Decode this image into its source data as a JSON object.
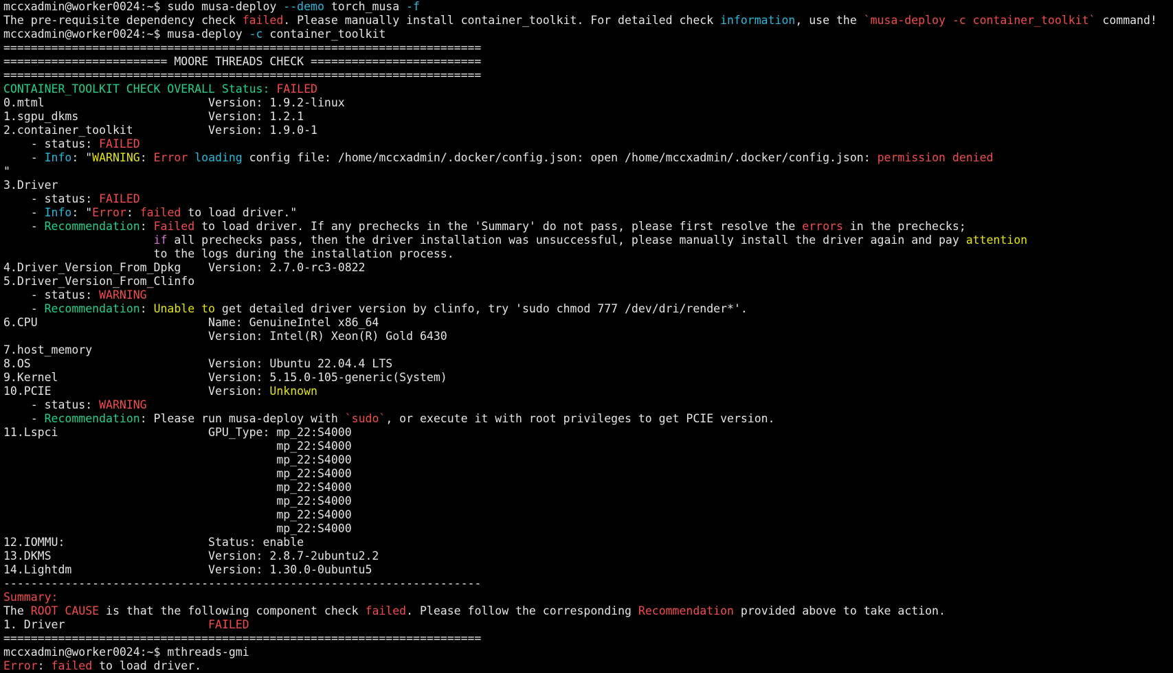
{
  "palette": {
    "default": "#e5e5e5",
    "red": "#f14c4c",
    "green": "#23d18b",
    "yellow": "#e5e510",
    "cyan": "#29b8db",
    "magenta": "#d670d6",
    "background": "#000000"
  },
  "terminal": {
    "lines": [
      [
        {
          "t": "mccxadmin@worker0024:~$ sudo musa-deploy ",
          "c": "default"
        },
        {
          "t": "--demo",
          "c": "cyan"
        },
        {
          "t": " torch_musa ",
          "c": "default"
        },
        {
          "t": "-f",
          "c": "cyan"
        }
      ],
      [
        {
          "t": "The pre-requisite dependency check ",
          "c": "default"
        },
        {
          "t": "failed",
          "c": "red"
        },
        {
          "t": ". Please manually install container_toolkit. For detailed check ",
          "c": "default"
        },
        {
          "t": "information",
          "c": "cyan"
        },
        {
          "t": ", use the ",
          "c": "default"
        },
        {
          "t": "`musa-deploy -c container_toolkit`",
          "c": "red"
        },
        {
          "t": " command!",
          "c": "default"
        }
      ],
      [
        {
          "t": "mccxadmin@worker0024:~$ musa-deploy ",
          "c": "default"
        },
        {
          "t": "-c",
          "c": "cyan"
        },
        {
          "t": " container_toolkit",
          "c": "default"
        }
      ],
      [
        {
          "t": "======================================================================",
          "c": "default"
        }
      ],
      [
        {
          "t": "======================== MOORE THREADS CHECK =========================",
          "c": "default"
        }
      ],
      [
        {
          "t": "======================================================================",
          "c": "default"
        }
      ],
      [
        {
          "t": "CONTAINER_TOOLKIT CHECK OVERALL Status: ",
          "c": "green"
        },
        {
          "t": "FAILED",
          "c": "red"
        }
      ],
      [
        {
          "t": "0.mtml                        Version: 1.9.2-linux",
          "c": "default"
        }
      ],
      [
        {
          "t": "1.sgpu_dkms                   Version: 1.2.1",
          "c": "default"
        }
      ],
      [
        {
          "t": "2.container_toolkit           Version: 1.9.0-1",
          "c": "default"
        }
      ],
      [
        {
          "t": "    - status: ",
          "c": "default"
        },
        {
          "t": "FAILED",
          "c": "red"
        }
      ],
      [
        {
          "t": "    - ",
          "c": "default"
        },
        {
          "t": "Info",
          "c": "cyan"
        },
        {
          "t": ": \"",
          "c": "default"
        },
        {
          "t": "WARNING",
          "c": "yellow"
        },
        {
          "t": ": ",
          "c": "default"
        },
        {
          "t": "Error",
          "c": "red"
        },
        {
          "t": " ",
          "c": "default"
        },
        {
          "t": "loading",
          "c": "cyan"
        },
        {
          "t": " config file: /home/mccxadmin/.docker/config.json: open /home/mccxadmin/.docker/config.json: ",
          "c": "default"
        },
        {
          "t": "permission denied",
          "c": "red"
        }
      ],
      [
        {
          "t": "\"",
          "c": "default"
        }
      ],
      [
        {
          "t": "3.Driver",
          "c": "default"
        }
      ],
      [
        {
          "t": "    - status: ",
          "c": "default"
        },
        {
          "t": "FAILED",
          "c": "red"
        }
      ],
      [
        {
          "t": "    - ",
          "c": "default"
        },
        {
          "t": "Info",
          "c": "cyan"
        },
        {
          "t": ": \"",
          "c": "default"
        },
        {
          "t": "Error",
          "c": "red"
        },
        {
          "t": ": ",
          "c": "default"
        },
        {
          "t": "failed",
          "c": "red"
        },
        {
          "t": " to load driver.\"",
          "c": "default"
        }
      ],
      [
        {
          "t": "    - ",
          "c": "default"
        },
        {
          "t": "Recommendation",
          "c": "green"
        },
        {
          "t": ": ",
          "c": "default"
        },
        {
          "t": "Failed",
          "c": "red"
        },
        {
          "t": " to load driver. If any prechecks in the 'Summary' do not pass, please first resolve the ",
          "c": "default"
        },
        {
          "t": "errors",
          "c": "red"
        },
        {
          "t": " in the prechecks;",
          "c": "default"
        }
      ],
      [
        {
          "t": "                      ",
          "c": "default"
        },
        {
          "t": "if",
          "c": "magenta"
        },
        {
          "t": " all prechecks pass, then the driver installation was unsuccessful, please manually install the driver again and pay ",
          "c": "default"
        },
        {
          "t": "attention",
          "c": "yellow"
        }
      ],
      [
        {
          "t": "                      to the logs during the installation process.",
          "c": "default"
        }
      ],
      [
        {
          "t": "4.Driver_Version_From_Dpkg    Version: 2.7.0-rc3-0822",
          "c": "default"
        }
      ],
      [
        {
          "t": "5.Driver_Version_From_Clinfo",
          "c": "default"
        }
      ],
      [
        {
          "t": "    - status: ",
          "c": "default"
        },
        {
          "t": "WARNING",
          "c": "red"
        }
      ],
      [
        {
          "t": "    - ",
          "c": "default"
        },
        {
          "t": "Recommendation",
          "c": "green"
        },
        {
          "t": ": ",
          "c": "default"
        },
        {
          "t": "Unable to",
          "c": "yellow"
        },
        {
          "t": " get detailed driver version by clinfo, try 'sudo chmod 777 /dev/dri/render*'.",
          "c": "default"
        }
      ],
      [
        {
          "t": "6.CPU                         Name: GenuineIntel x86_64",
          "c": "default"
        }
      ],
      [
        {
          "t": "                              Version: Intel(R) Xeon(R) Gold 6430",
          "c": "default"
        }
      ],
      [
        {
          "t": "7.host_memory",
          "c": "default"
        }
      ],
      [
        {
          "t": "8.OS                          Version: Ubuntu 22.04.4 LTS",
          "c": "default"
        }
      ],
      [
        {
          "t": "9.Kernel                      Version: 5.15.0-105-generic(System)",
          "c": "default"
        }
      ],
      [
        {
          "t": "10.PCIE                       Version: ",
          "c": "default"
        },
        {
          "t": "Unknown",
          "c": "yellow"
        }
      ],
      [
        {
          "t": "    - status: ",
          "c": "default"
        },
        {
          "t": "WARNING",
          "c": "red"
        }
      ],
      [
        {
          "t": "    - ",
          "c": "default"
        },
        {
          "t": "Recommendation",
          "c": "green"
        },
        {
          "t": ": Please run musa-deploy with ",
          "c": "default"
        },
        {
          "t": "`sudo`",
          "c": "red"
        },
        {
          "t": ", or execute it with root privileges to get PCIE version.",
          "c": "default"
        }
      ],
      [
        {
          "t": "11.Lspci                      GPU_Type: mp_22:S4000",
          "c": "default"
        }
      ],
      [
        {
          "t": "                                        mp_22:S4000",
          "c": "default"
        }
      ],
      [
        {
          "t": "                                        mp_22:S4000",
          "c": "default"
        }
      ],
      [
        {
          "t": "                                        mp_22:S4000",
          "c": "default"
        }
      ],
      [
        {
          "t": "                                        mp_22:S4000",
          "c": "default"
        }
      ],
      [
        {
          "t": "                                        mp_22:S4000",
          "c": "default"
        }
      ],
      [
        {
          "t": "                                        mp_22:S4000",
          "c": "default"
        }
      ],
      [
        {
          "t": "                                        mp_22:S4000",
          "c": "default"
        }
      ],
      [
        {
          "t": "12.IOMMU:                     Status: enable",
          "c": "default"
        }
      ],
      [
        {
          "t": "13.DKMS                       Version: 2.8.7-2ubuntu2.2",
          "c": "default"
        }
      ],
      [
        {
          "t": "14.Lightdm                    Version: 1.30.0-0ubuntu5",
          "c": "default"
        }
      ],
      [
        {
          "t": "----------------------------------------------------------------------",
          "c": "default"
        }
      ],
      [
        {
          "t": "Summary:",
          "c": "red"
        }
      ],
      [
        {
          "t": "The ",
          "c": "default"
        },
        {
          "t": "ROOT CAUSE",
          "c": "red"
        },
        {
          "t": " is that the following component check ",
          "c": "default"
        },
        {
          "t": "failed",
          "c": "red"
        },
        {
          "t": ". Please follow the corresponding ",
          "c": "default"
        },
        {
          "t": "Recommendation",
          "c": "red"
        },
        {
          "t": " provided above to take action.",
          "c": "default"
        }
      ],
      [
        {
          "t": "1. Driver                     ",
          "c": "default"
        },
        {
          "t": "FAILED",
          "c": "red"
        }
      ],
      [
        {
          "t": "======================================================================",
          "c": "default"
        }
      ],
      [
        {
          "t": "mccxadmin@worker0024:~$ mthreads-gmi",
          "c": "default"
        }
      ],
      [
        {
          "t": "Error",
          "c": "red"
        },
        {
          "t": ": ",
          "c": "default"
        },
        {
          "t": "failed",
          "c": "red"
        },
        {
          "t": " to load driver.",
          "c": "default"
        }
      ]
    ]
  }
}
